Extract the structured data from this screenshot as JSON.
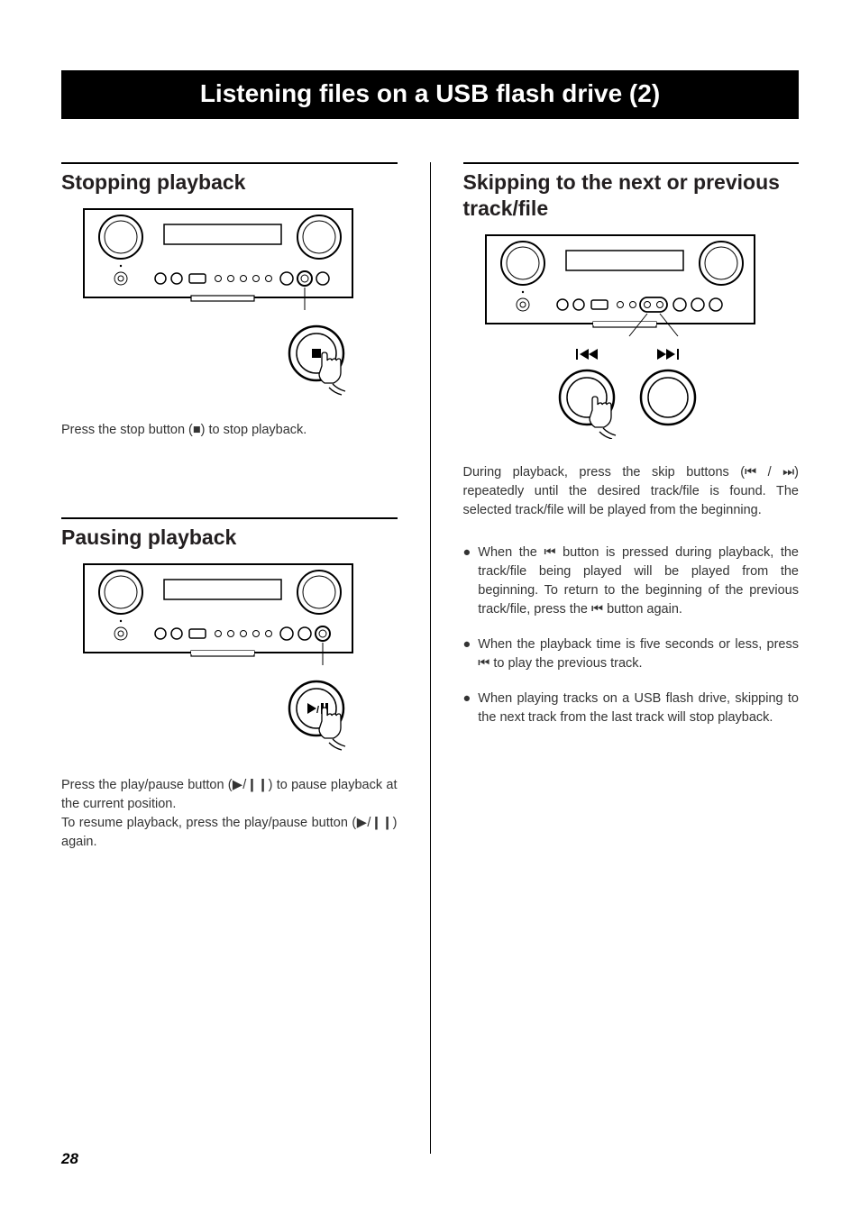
{
  "title": "Listening files on a USB flash drive (2)",
  "page_number": "28",
  "left": {
    "stop": {
      "heading": "Stopping playback",
      "text_pre": "Press the stop button (",
      "text_post": ") to stop playback."
    },
    "pause": {
      "heading": "Pausing playback",
      "text1_pre": "Press the play/pause button (",
      "text1_mid": "/",
      "text1_post": ") to pause playback at the current position.",
      "text2_pre": "To resume playback, press the play/pause button (",
      "text2_mid": "/",
      "text2_post": ") again."
    }
  },
  "right": {
    "skip": {
      "heading": "Skipping to the next or previous track/file",
      "intro_pre": "During playback, press the skip buttons (",
      "intro_sep": " / ",
      "intro_post": ") repeatedly until the desired track/file is found. The selected track/file will be played from the beginning.",
      "b1_a": "When the ",
      "b1_b": " button is pressed during playback, the track/file being played will be played from the beginning. To return to the beginning of the previous track/file, press the ",
      "b1_c": " button again.",
      "b2_a": "When the playback time is five seconds or less, press ",
      "b2_b": " to play the previous track.",
      "b3": "When playing tracks on a USB flash drive, skipping to the next track from the last track will stop playback."
    }
  },
  "glyphs": {
    "stop": "■",
    "play": "▶",
    "pause": "❙❙",
    "prev": "⏮",
    "next": "⏭",
    "bullet": "●"
  }
}
